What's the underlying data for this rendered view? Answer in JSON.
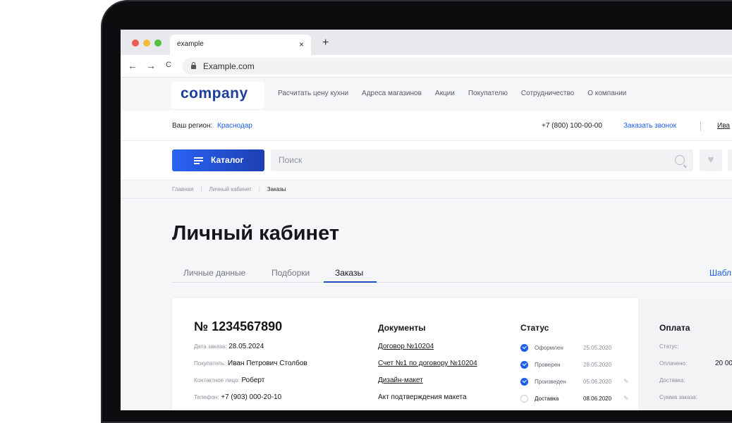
{
  "browser": {
    "tab_title": "example",
    "tab_close": "×",
    "new_tab": "+",
    "back": "←",
    "forward": "→",
    "reload": "C",
    "url": "Example.com"
  },
  "colors": {
    "brand": "#1c3f9e",
    "accent": "#1e5ee8",
    "dot_red": "#ee5b55",
    "dot_yellow": "#f2bc3b",
    "dot_green": "#55c043"
  },
  "site": {
    "logo": "company",
    "menu": [
      "Расчитать цену кухни",
      "Адреса магазинов",
      "Акции",
      "Покупателю",
      "Сотрудничество",
      "О компании"
    ],
    "region_label": "Ваш регион:",
    "region_value": "Краснодар",
    "phone": "+7 (800) 100-00-00",
    "callback": "Заказать звонок",
    "user": "Ива",
    "catalog_label": "Каталог",
    "search_placeholder": "Поиск",
    "fav_icon": "♥"
  },
  "breadcrumbs": [
    "Главная",
    "Личный кабинет",
    "Заказы"
  ],
  "page": {
    "title": "Личный кабинет",
    "tabs": [
      "Личные данные",
      "Подборки",
      "Заказы"
    ],
    "templates_link": "Шабл"
  },
  "order": {
    "number": "№ 1234567890",
    "fields": [
      {
        "label": "Дата заказа:",
        "value": "28.05.2024"
      },
      {
        "label": "Покупатель:",
        "value": "Иван Петрович Столбов"
      },
      {
        "label": "Контактное лицо:",
        "value": "Роберт"
      },
      {
        "label": "Телефон:",
        "value": "+7 (903) 000-20-10"
      }
    ],
    "documents_title": "Документы",
    "documents": [
      "Договор №10204",
      "Счет №1 по договору №10204",
      "Дизайн-макет",
      "Акт подтверждения макета"
    ],
    "status_title": "Статус",
    "statuses": [
      {
        "name": "Оформлен",
        "date": "25.05.2020",
        "done": true
      },
      {
        "name": "Проверен",
        "date": "28.05.2020",
        "done": true
      },
      {
        "name": "Произведен",
        "date": "05.06.2020",
        "done": true
      },
      {
        "name": "Доставка",
        "date": "08.06.2020",
        "done": false
      }
    ],
    "pencil_icon": "✎"
  },
  "payment": {
    "title": "Оплата",
    "rows": [
      {
        "label": "Статус:",
        "value": ""
      },
      {
        "label": "Оплачено:",
        "value": "20 00"
      },
      {
        "label": "Доставка:",
        "value": ""
      },
      {
        "label": "Сумма заказа:",
        "value": ""
      }
    ]
  }
}
